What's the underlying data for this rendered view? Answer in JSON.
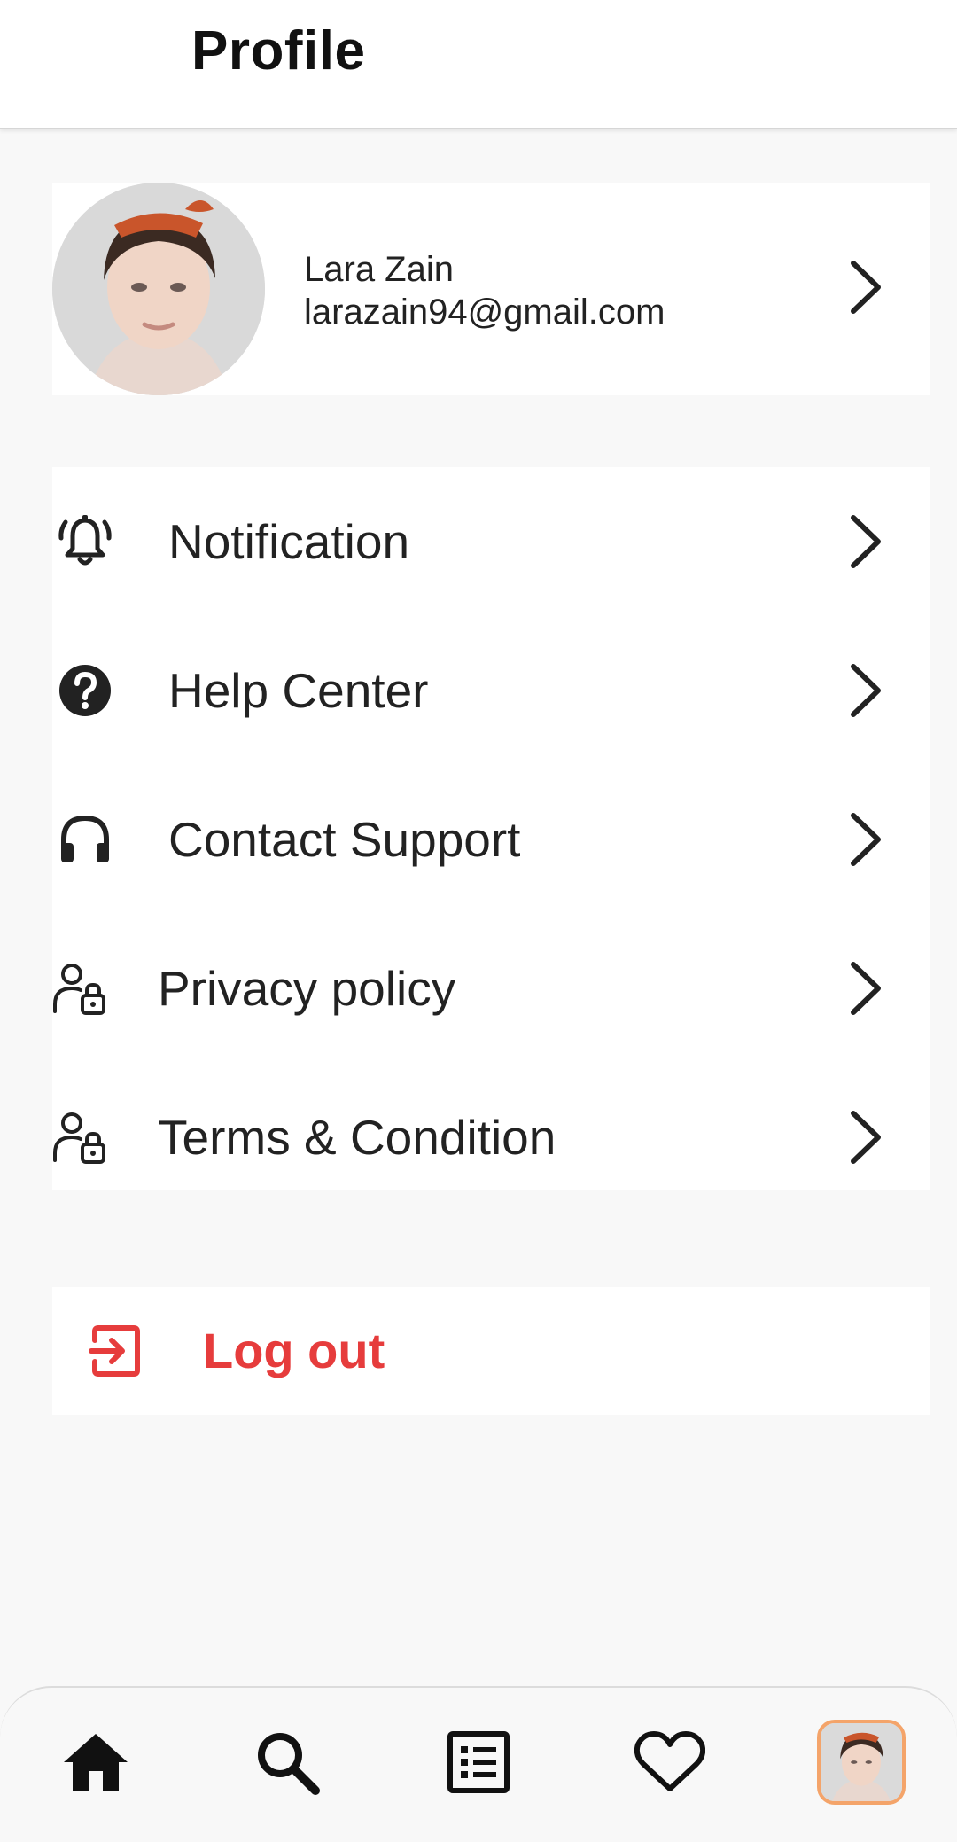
{
  "header": {
    "title": "Profile"
  },
  "profile": {
    "name": "Lara Zain",
    "email": "larazain94@gmail.com",
    "avatar_icon": "user-avatar-photo"
  },
  "menu": {
    "items": [
      {
        "label": "Notification",
        "icon": "bell-icon"
      },
      {
        "label": "Help Center",
        "icon": "help-circle-icon"
      },
      {
        "label": "Contact Support",
        "icon": "headset-icon"
      },
      {
        "label": "Privacy policy",
        "icon": "user-lock-icon"
      },
      {
        "label": "Terms & Condition",
        "icon": "user-lock-icon"
      }
    ]
  },
  "logout": {
    "label": "Log out",
    "icon": "logout-icon"
  },
  "bottom_nav": {
    "items": [
      {
        "icon": "home-icon"
      },
      {
        "icon": "search-icon"
      },
      {
        "icon": "list-icon"
      },
      {
        "icon": "heart-icon"
      },
      {
        "icon": "profile-avatar"
      }
    ]
  },
  "colors": {
    "danger": "#e63c3c",
    "avatar_border": "#f4a46a",
    "text": "#222222",
    "background": "#f8f8f8"
  }
}
